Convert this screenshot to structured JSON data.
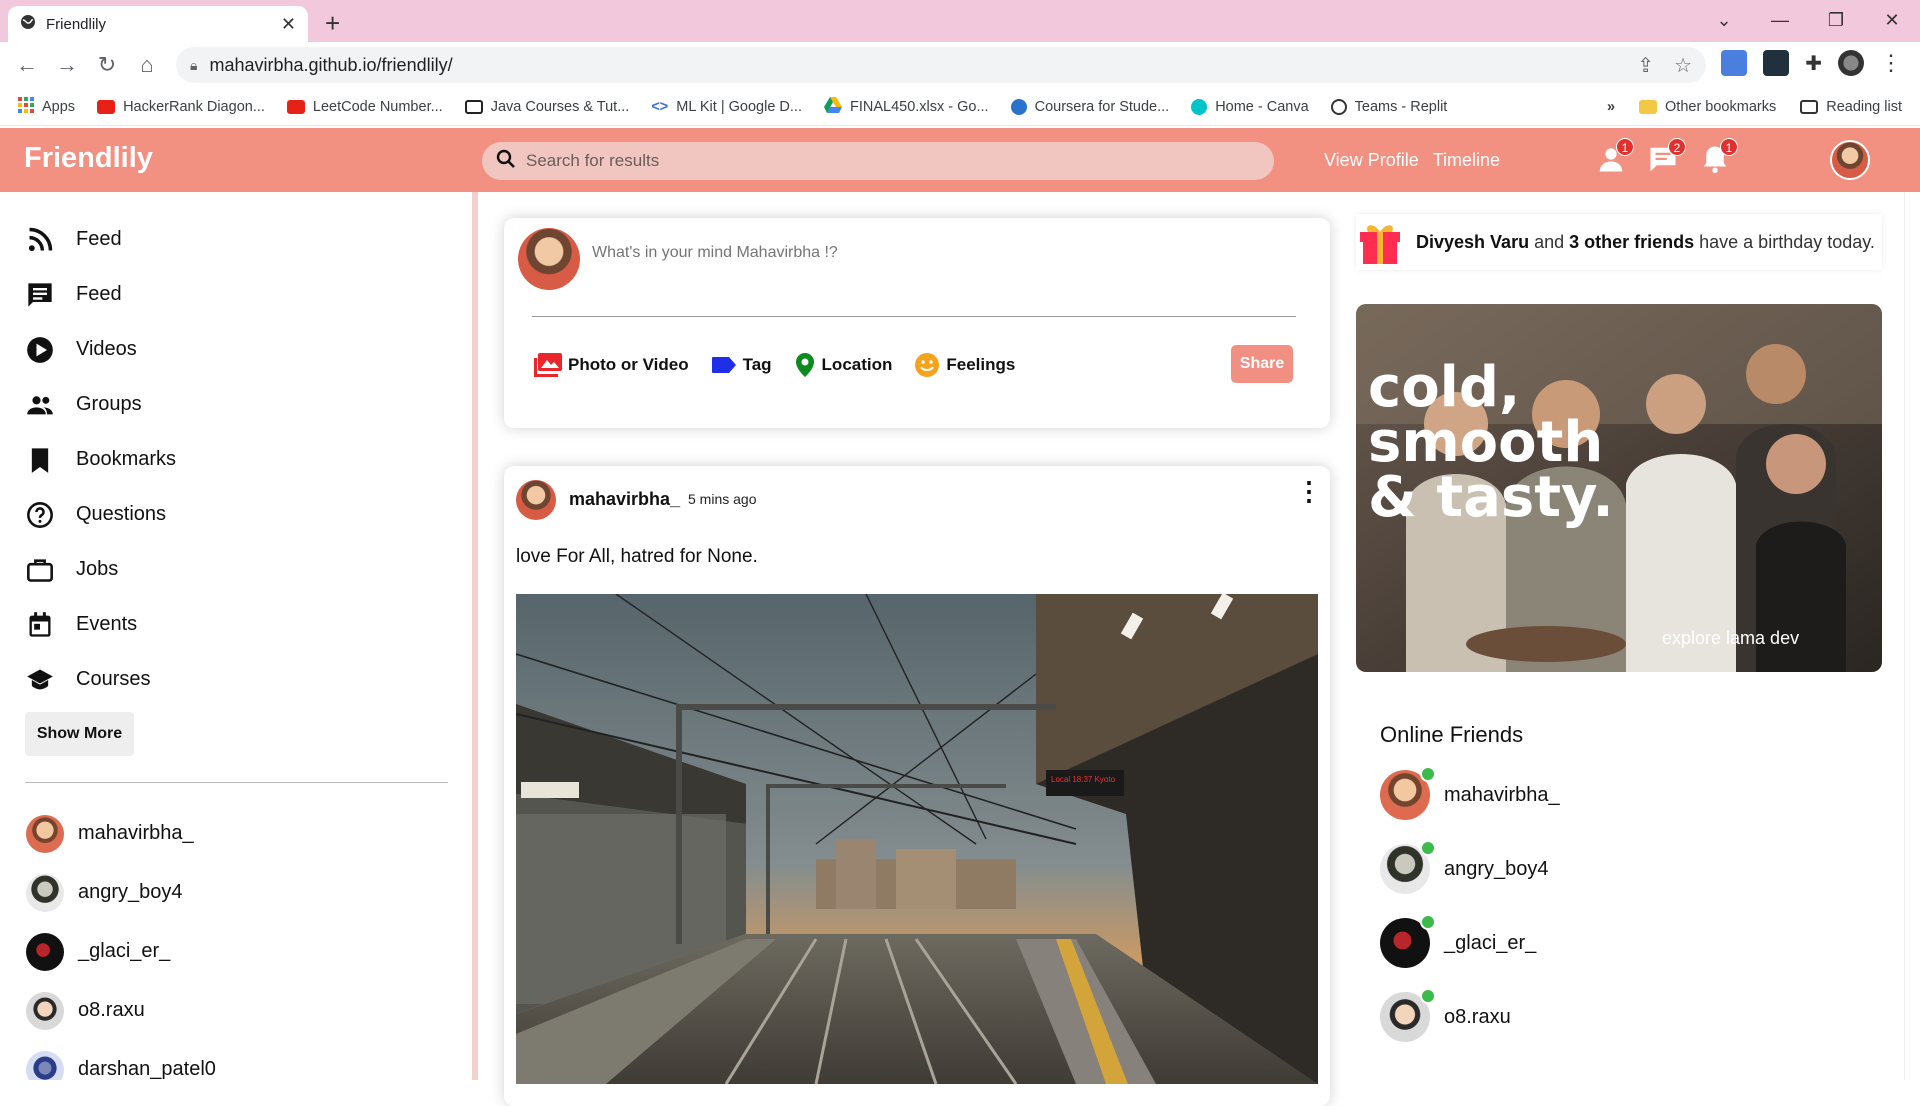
{
  "browser": {
    "tab_title": "Friendlily",
    "url": "mahavirbha.github.io/friendlily/",
    "bookmarks": [
      {
        "label": "Apps",
        "color": "#4285f4"
      },
      {
        "label": "HackerRank Diagon...",
        "color": "#e62117"
      },
      {
        "label": "LeetCode Number...",
        "color": "#e62117"
      },
      {
        "label": "Java Courses & Tut...",
        "color": "#222222"
      },
      {
        "label": "ML Kit | Google D...",
        "color": "#3a6fd8"
      },
      {
        "label": "FINAL450.xlsx - Go...",
        "color": "#0f9d58"
      },
      {
        "label": "Coursera for Stude...",
        "color": "#2a73cc"
      },
      {
        "label": "Home - Canva",
        "color": "#00c4cc"
      },
      {
        "label": "Teams - Replit",
        "color": "#333333"
      }
    ],
    "more_label": "»",
    "other_bookmarks": "Other bookmarks",
    "reading_list": "Reading list"
  },
  "app": {
    "logo": "Friendlily",
    "search_placeholder": "Search for results",
    "links": {
      "profile": "View Profile",
      "timeline": "Timeline"
    },
    "badges": {
      "friends": "1",
      "messages": "2",
      "notifications": "1"
    },
    "accent": "#f29082"
  },
  "sidebar": {
    "items": [
      {
        "label": "Feed",
        "icon": "rss-icon"
      },
      {
        "label": "Feed",
        "icon": "chat-icon"
      },
      {
        "label": "Videos",
        "icon": "play-circle-icon"
      },
      {
        "label": "Groups",
        "icon": "group-icon"
      },
      {
        "label": "Bookmarks",
        "icon": "bookmark-icon"
      },
      {
        "label": "Questions",
        "icon": "help-circle-icon"
      },
      {
        "label": "Jobs",
        "icon": "briefcase-icon"
      },
      {
        "label": "Events",
        "icon": "calendar-icon"
      },
      {
        "label": "Courses",
        "icon": "school-icon"
      }
    ],
    "show_more": "Show More",
    "friends": [
      "mahavirbha_",
      "angry_boy4",
      "_glaci_er_",
      "o8.raxu",
      "darshan_patel0"
    ]
  },
  "share": {
    "placeholder": "What's in your mind Mahavirbha !?",
    "options": {
      "photo": "Photo or Video",
      "tag": "Tag",
      "location": "Location",
      "feelings": "Feelings"
    },
    "button": "Share"
  },
  "post": {
    "username": "mahavirbha_",
    "time": "5 mins ago",
    "text": "love For All, hatred for None.",
    "image_sign": "Local 18:37 Kyoto"
  },
  "right": {
    "birthday": {
      "name": "Divyesh Varu",
      "mid": " and ",
      "others": "3 other friends",
      "rest": " have a birthday today."
    },
    "ad": {
      "headline_1": "cold,",
      "headline_2": "smooth",
      "headline_3": "& tasty.",
      "footer": "explore lama dev"
    },
    "online_title": "Online Friends",
    "online_friends": [
      "mahavirbha_",
      "angry_boy4",
      "_glaci_er_",
      "o8.raxu"
    ]
  }
}
